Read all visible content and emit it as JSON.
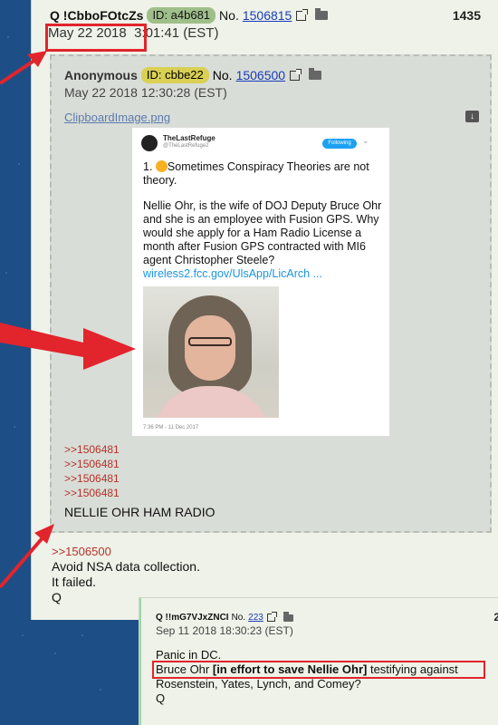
{
  "post": {
    "tripcode": "Q !CbboFOtcZs",
    "id_label": "ID: a4b681",
    "no_prefix": "No.",
    "post_no": "1506815",
    "right_number": "1435",
    "date_part": "May 22 2018",
    "time_part": "3:01:41 (EST)",
    "body_reply": ">>1506500",
    "body_lines": [
      "Avoid NSA data collection.",
      "It failed.",
      "Q"
    ]
  },
  "quote": {
    "name": "Anonymous",
    "id_label": "ID: cbbe22",
    "no_prefix": "No.",
    "post_no": "1506500",
    "date": "May 22 2018 12:30:28 (EST)",
    "filename": "ClipboardImage.png",
    "replies": [
      ">>1506481",
      ">>1506481",
      ">>1506481",
      ">>1506481"
    ],
    "body": "NELLIE OHR HAM RADIO"
  },
  "tweet": {
    "name": "TheLastRefuge",
    "handle": "@TheLastRefuge2",
    "follow_label": "Following",
    "para1": "1. 🤔Sometimes Conspiracy Theories are not theory.",
    "para1_prefix": "1. ",
    "para1_text": "Sometimes Conspiracy Theories are not theory.",
    "para2": "Nellie Ohr, is the wife of DOJ Deputy Bruce Ohr and she is an employee with Fusion GPS.  Why would she apply for a Ham Radio License a month after Fusion GPS contracted with MI6 agent Christopher Steele?",
    "link": "wireless2.fcc.gov/UlsApp/LicArch ...",
    "timestamp": "7:36 PM - 11 Dec 2017"
  },
  "post2": {
    "tripcode": "Q !!mG7VJxZNCI",
    "no_prefix": "No.",
    "post_no": "223",
    "date": "Sep 11 2018 18:30:23 (EST)",
    "corner": "2",
    "line1": "Panic in DC.",
    "line2_start": "Bruce Ohr ",
    "line2_bold": "[in effort to save Nellie Ohr]",
    "line2_end": " testifying against",
    "line3": "Rosenstein, Yates, Lynch, and Comey?",
    "line4": "Q"
  },
  "colors": {
    "background": "#1d4f86",
    "highlight_red": "#e2242c",
    "reply_red": "#b5312a",
    "link_blue": "#1a3bb8"
  }
}
